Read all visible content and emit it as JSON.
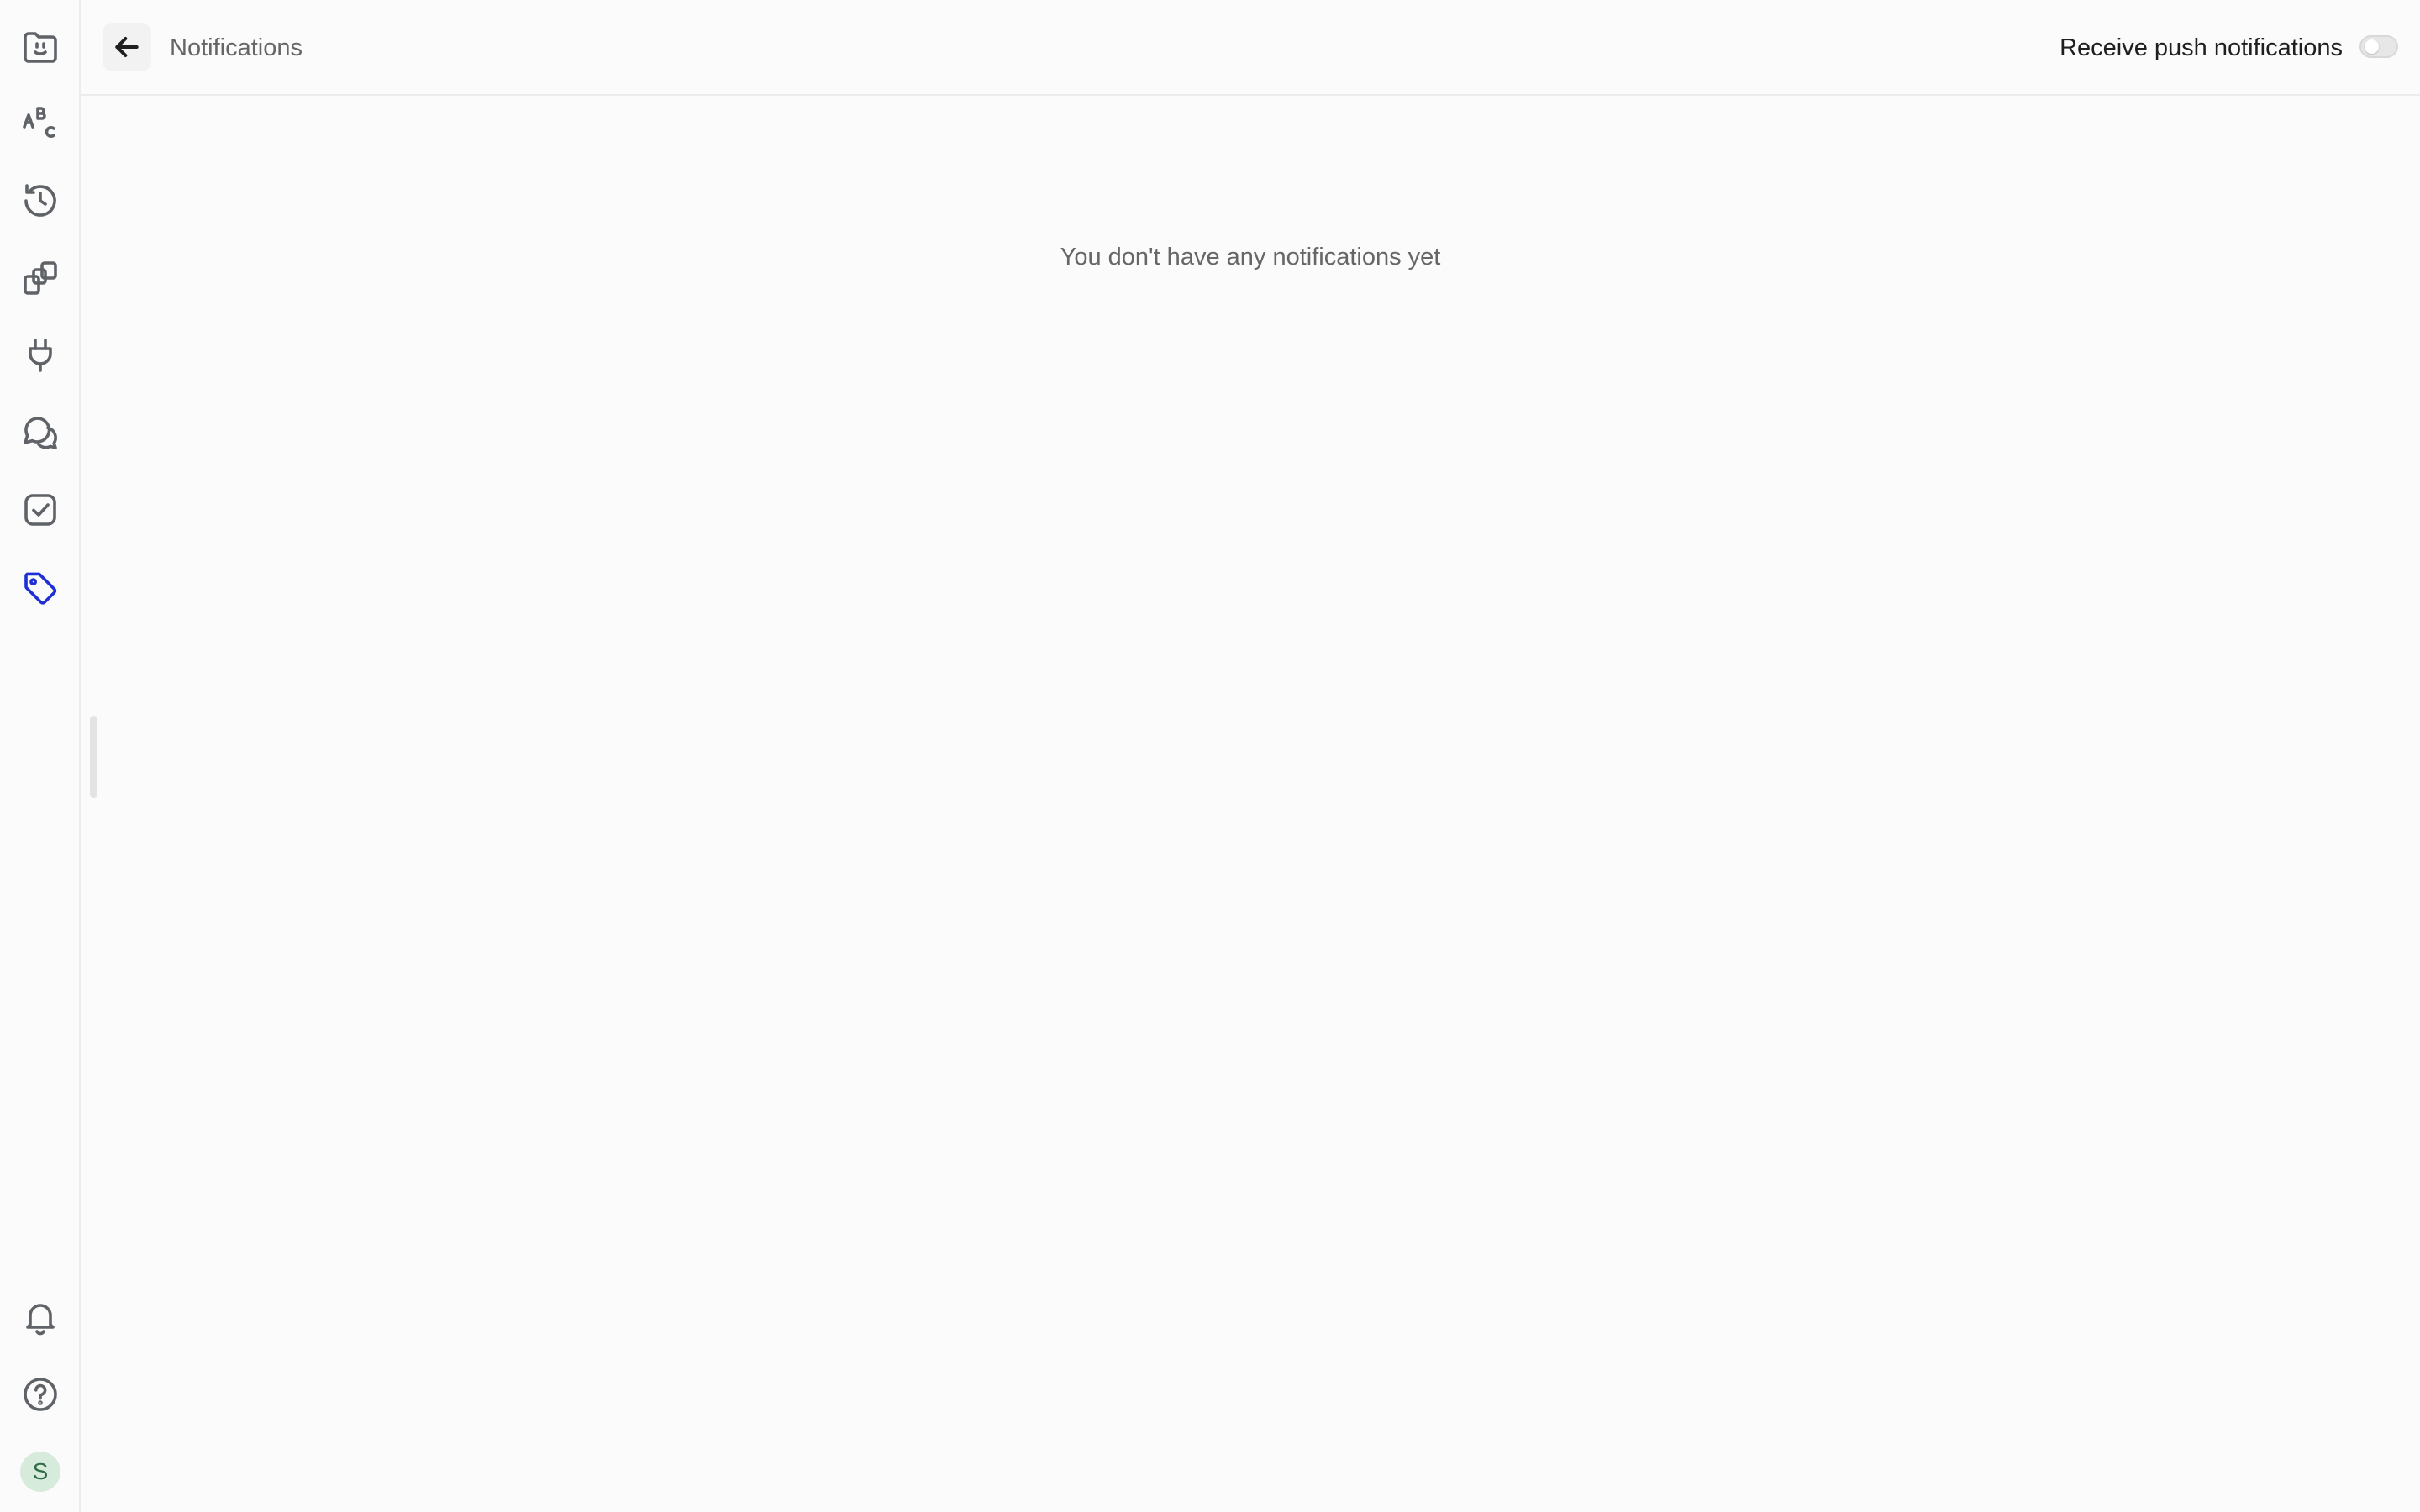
{
  "header": {
    "title": "Notifications",
    "push_label": "Receive push notifications",
    "push_enabled": false
  },
  "main": {
    "empty_message": "You don't have any notifications yet"
  },
  "sidebar": {
    "items": [
      {
        "icon": "face-folder-icon"
      },
      {
        "icon": "abc-icon"
      },
      {
        "icon": "history-icon"
      },
      {
        "icon": "copy-icon"
      },
      {
        "icon": "plug-icon"
      },
      {
        "icon": "chat-icon"
      },
      {
        "icon": "check-square-icon"
      },
      {
        "icon": "tag-icon",
        "active": true
      }
    ],
    "bottom_items": [
      {
        "icon": "bell-icon"
      },
      {
        "icon": "help-icon"
      }
    ],
    "avatar_initial": "S"
  },
  "colors": {
    "accent": "#1f2fd6",
    "icon": "#5f6368",
    "avatar_bg": "#d7ebdc",
    "avatar_text": "#2f6b45"
  }
}
